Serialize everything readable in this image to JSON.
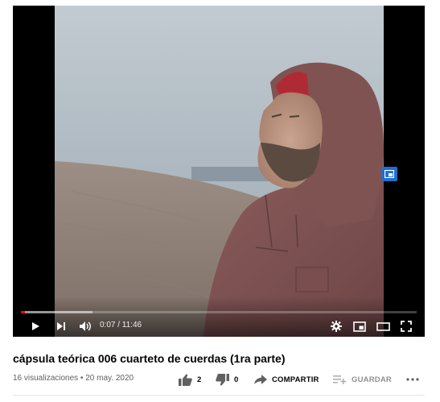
{
  "video": {
    "current_time": "0:07",
    "duration": "11:46",
    "progress_played": 0.01,
    "progress_loaded": 0.18,
    "time_separator": " / ",
    "time_display": "0:07 / 11:46"
  },
  "icons": {
    "play": "play-icon",
    "next": "next-icon",
    "volume": "volume-icon",
    "settings": "gear-icon",
    "miniplayer": "miniplayer-icon",
    "theater": "theater-icon",
    "fullscreen": "fullscreen-icon",
    "cast": "cast-icon",
    "like": "thumbs-up-icon",
    "dislike": "thumbs-down-icon",
    "share": "share-icon",
    "save": "playlist-add-icon",
    "more": "more-icon"
  },
  "colors": {
    "progress_red": "#ff0000",
    "cast_blue": "#1f6fd0",
    "title_text": "#030303",
    "meta_text": "#606060"
  },
  "title": "cápsula teórica 006 cuarteto de cuerdas (1ra parte)",
  "meta": "16 visualizaciones • 20 may. 2020",
  "actions": {
    "likes": "2",
    "dislikes": "0",
    "share_label": "COMPARTIR",
    "save_label": "GUARDAR"
  }
}
